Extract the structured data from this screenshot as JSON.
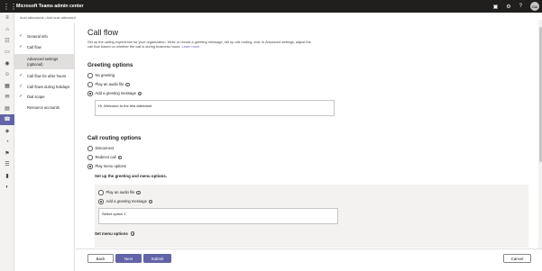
{
  "app": {
    "title": "Microsoft Teams admin center",
    "avatar_initials": "CA"
  },
  "breadcrumb": "Auto attendants \\ Add auto attendant",
  "steps": [
    {
      "label": "General info",
      "done": true
    },
    {
      "label": "Call flow",
      "done": true
    },
    {
      "label": "Advanced settings (optional)",
      "done": false,
      "current": true
    },
    {
      "label": "Call flow for after hours",
      "done": true
    },
    {
      "label": "Call flows during holidays",
      "done": true
    },
    {
      "label": "Dial scope",
      "done": true
    },
    {
      "label": "Resource accounts",
      "done": false
    }
  ],
  "page": {
    "title": "Call flow",
    "description": "Set up the calling experience for your organization. Write or record a greeting message, set up call routing, and, in Advanced settings, adjust the call flow based on whether the call is during business hours.",
    "learn_more": "Learn more"
  },
  "greeting": {
    "title": "Greeting options",
    "options": [
      "No greeting",
      "Play an audio file",
      "Add a greeting message"
    ],
    "selected": "Add a greeting message",
    "message_value": "Hi, Welcome to the test attendant"
  },
  "routing": {
    "title": "Call routing options",
    "options": [
      "Disconnect",
      "Redirect call",
      "Play menu options"
    ],
    "selected": "Play menu options",
    "subtitle": "Set up the greeting and menu options.",
    "menu_greeting_options": [
      "Play an audio file",
      "Add a greeting message"
    ],
    "menu_greeting_selected": "Add a greeting message",
    "menu_message_value": "Select option 1",
    "set_menu_options": "Set menu options"
  },
  "footer": {
    "back": "Back",
    "next": "Next",
    "submit": "Submit",
    "cancel": "Cancel"
  },
  "colors": {
    "accent": "#6264a7",
    "topbar": "#201f1e"
  }
}
